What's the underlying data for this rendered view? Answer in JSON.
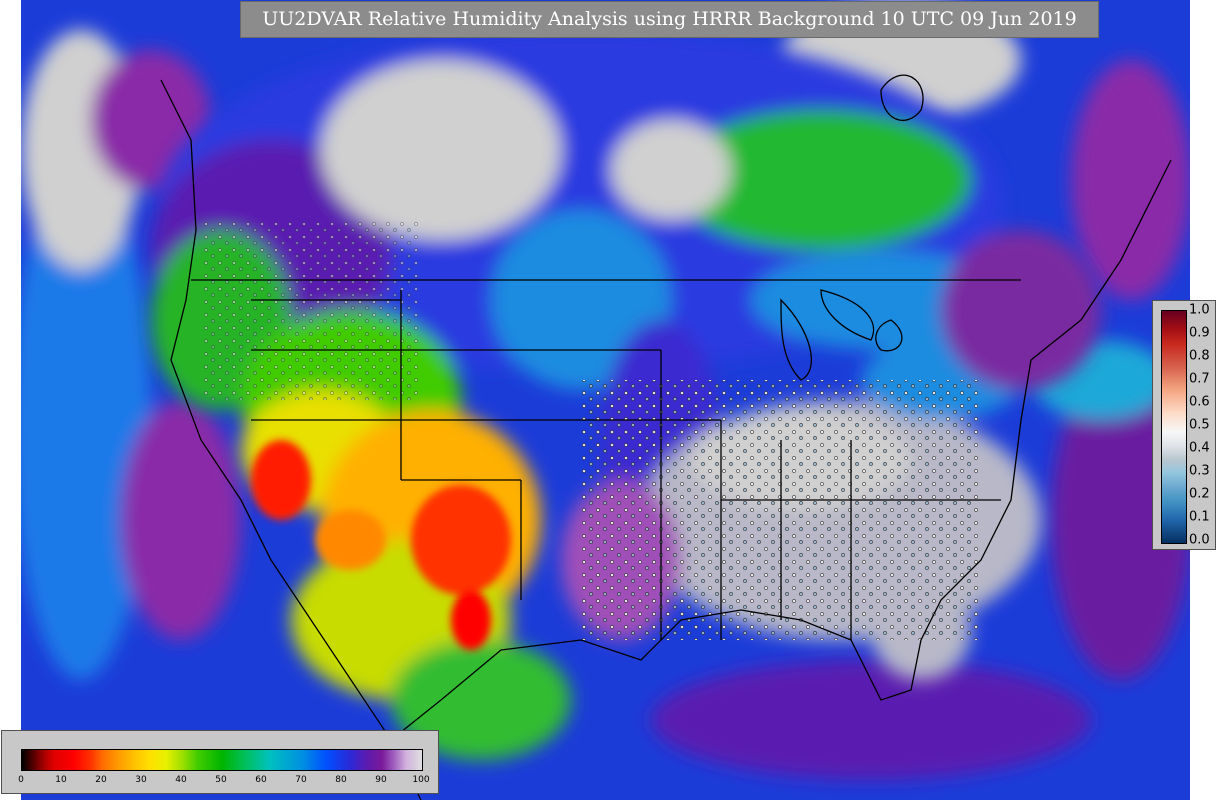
{
  "title": "UU2DVAR Relative Humidity Analysis using HRRR Background 10 UTC 09 Jun 2019",
  "colorbar_main": {
    "ticks": [
      "0",
      "10",
      "20",
      "30",
      "40",
      "50",
      "60",
      "70",
      "80",
      "90",
      "100"
    ],
    "range": [
      0,
      100
    ]
  },
  "colorbar_side": {
    "ticks": [
      "1.0",
      "0.9",
      "0.8",
      "0.7",
      "0.6",
      "0.5",
      "0.4",
      "0.3",
      "0.2",
      "0.1",
      "0.0"
    ],
    "range": [
      0,
      1
    ]
  },
  "colors": {
    "ocean": "#1c3cd8",
    "dry": "#ff0000",
    "moist": "#00b400",
    "humid": "#7a1a9a",
    "saturated": "#d8d8d8",
    "boundaries": "#000000"
  }
}
